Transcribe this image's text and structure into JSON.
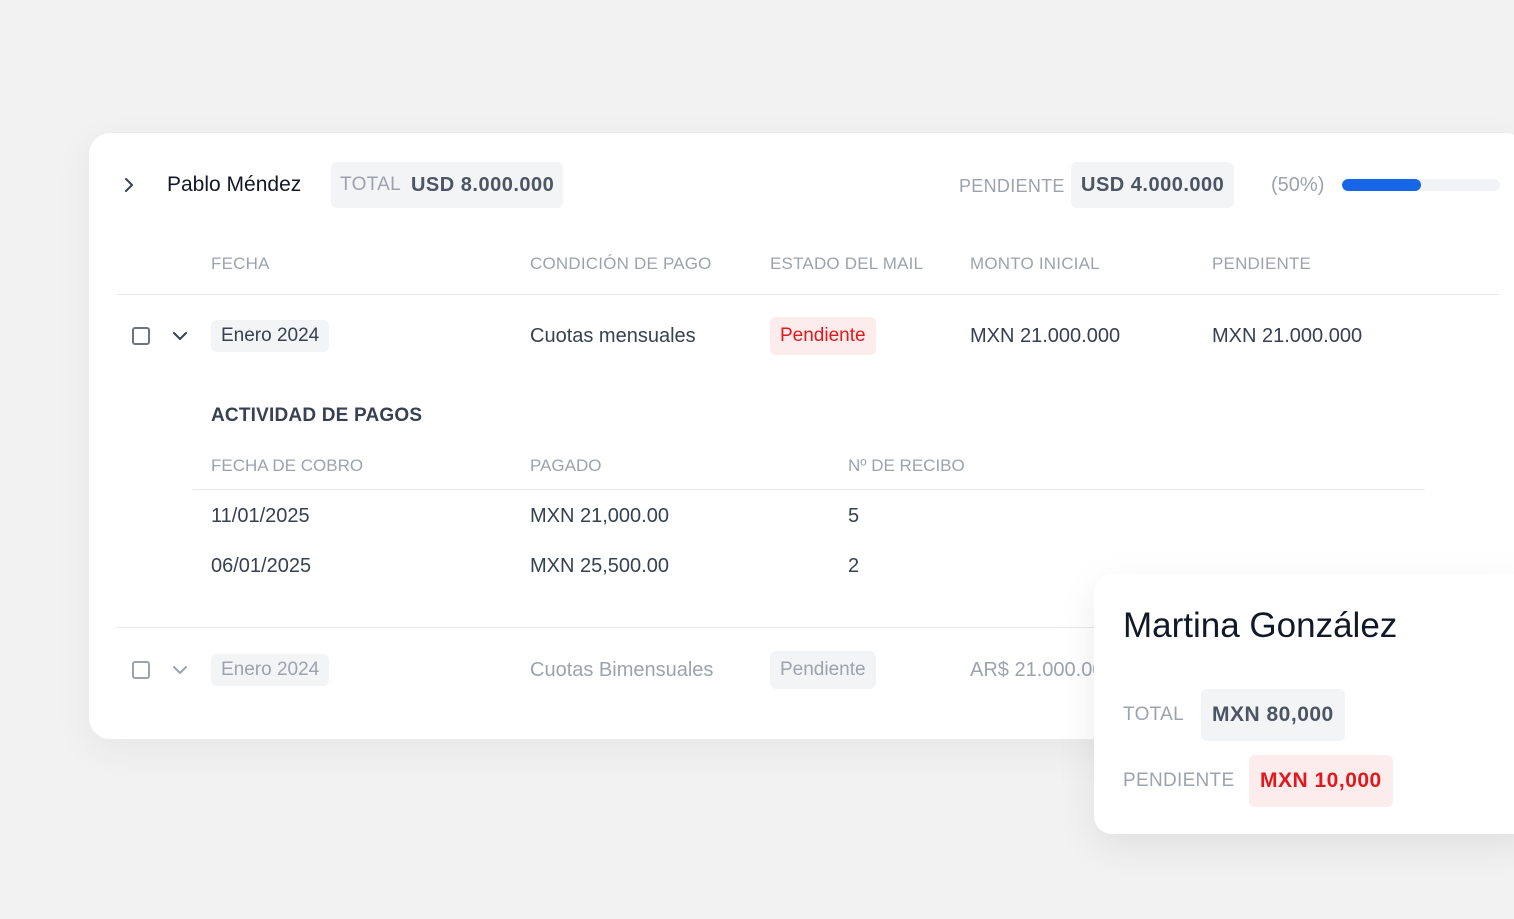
{
  "client": {
    "name": "Pablo Méndez",
    "total_label": "TOTAL",
    "total_value": "USD 8.000.000",
    "pending_label": "PENDIENTE",
    "pending_value": "USD 4.000.000",
    "pending_percent_text": "(50%)",
    "pending_fraction": 0.5
  },
  "table": {
    "headers": {
      "fecha": "FECHA",
      "condicion": "CONDICIÓN DE PAGO",
      "estado": "ESTADO DEL MAIL",
      "monto": "MONTO INICIAL",
      "pendiente": "PENDIENTE"
    },
    "rows": [
      {
        "fecha": "Enero 2024",
        "condicion": "Cuotas mensuales",
        "estado": "Pendiente",
        "monto": "MXN 21.000.000",
        "pendiente": "MXN 21.000.000"
      },
      {
        "fecha": "Enero 2024",
        "condicion": "Cuotas Bimensuales",
        "estado": "Pendiente",
        "monto": "AR$ 21.000.000"
      }
    ]
  },
  "actividad": {
    "title": "ACTIVIDAD DE PAGOS",
    "headers": {
      "fecha": "FECHA DE COBRO",
      "pagado": "PAGADO",
      "recibo": "Nº DE RECIBO"
    },
    "rows": [
      {
        "fecha": "11/01/2025",
        "pagado": "MXN 21,000.00",
        "recibo": "5"
      },
      {
        "fecha": "06/01/2025",
        "pagado": "MXN 25,500.00",
        "recibo": "2"
      }
    ]
  },
  "popover": {
    "name": "Martina González",
    "total_label": "TOTAL",
    "total_value": "MXN 80,000",
    "pending_label": "PENDIENTE",
    "pending_value": "MXN 10,000"
  },
  "colors": {
    "accent": "#1766e8",
    "danger": "#e0191e",
    "danger_bg": "#fdecec"
  },
  "icons": {
    "expand": "chevron-right-icon",
    "collapse": "chevron-down-icon",
    "checkbox": "checkbox"
  }
}
